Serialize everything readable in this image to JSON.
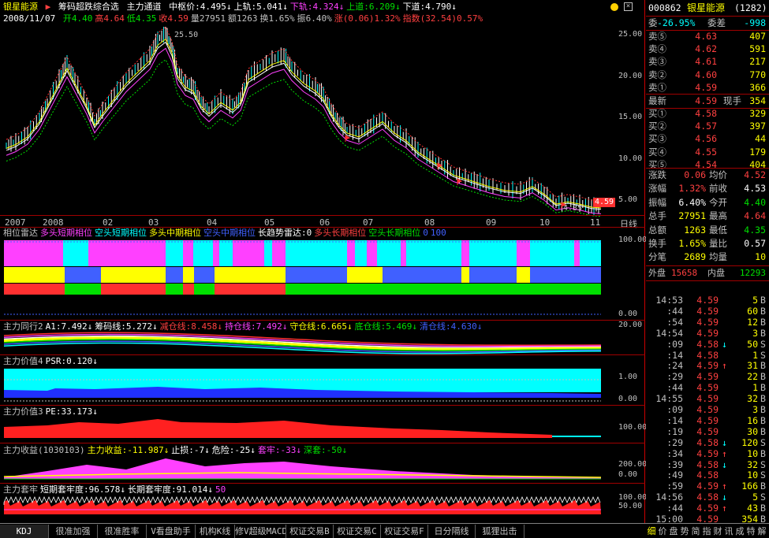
{
  "header": {
    "stock_name": "银星能源",
    "indicator_title": "筹码超跌综合选",
    "channel_label": "主力通道",
    "channel_values": [
      {
        "label": "中枢价:4.495",
        "color": "#ffffff"
      },
      {
        "label": "上轨:5.041",
        "color": "#ffffff"
      },
      {
        "label": "下轨:4.324",
        "color": "#ff40ff"
      },
      {
        "label": "上道:6.209",
        "color": "#00e000"
      },
      {
        "label": "下道:4.790",
        "color": "#ffffff"
      }
    ],
    "date": "2008/11/07",
    "quote_items": [
      {
        "label": "开4.40",
        "color": "#00e000"
      },
      {
        "label": "高4.64",
        "color": "#ff4040"
      },
      {
        "label": "低4.35",
        "color": "#00e000"
      },
      {
        "label": "收4.59",
        "color": "#ff4040"
      },
      {
        "label": "量27951",
        "color": "#c0c0c0"
      },
      {
        "label": "额1263",
        "color": "#c0c0c0"
      },
      {
        "label": "换1.65%",
        "color": "#c0c0c0"
      },
      {
        "label": "振6.40%",
        "color": "#c0c0c0"
      },
      {
        "label": "涨(0.06)1.32%",
        "color": "#ff4040"
      },
      {
        "label": "指数(32.54)0.57%",
        "color": "#ff4040"
      }
    ]
  },
  "main_chart": {
    "y_ticks": [
      "25.00",
      "20.00",
      "15.00",
      "10.00",
      "5.00"
    ],
    "peak_label": "25.50",
    "low_label": "4.35",
    "current_price": "4.59",
    "x_labels": [
      "2007",
      "2008",
      "02",
      "03",
      "04",
      "05",
      "06",
      "07",
      "08",
      "09",
      "10",
      "11"
    ],
    "period": "日线"
  },
  "panel1": {
    "items": [
      {
        "label": "相位雷达",
        "color": "#c0c0c0"
      },
      {
        "label": "多头短期相位",
        "color": "#ff40ff"
      },
      {
        "label": "空头短期相位",
        "color": "#00ffff"
      },
      {
        "label": "多头中期相位",
        "color": "#ffff00"
      },
      {
        "label": "空头中期相位",
        "color": "#4060ff"
      },
      {
        "label": "长趋势雷达:0",
        "color": "#ffffff"
      },
      {
        "label": "多头长期相位",
        "color": "#ff4040"
      },
      {
        "label": "空头长期相位",
        "color": "#00e000"
      },
      {
        "label": "0",
        "color": "#4060ff"
      },
      {
        "label": "100",
        "color": "#4060ff"
      }
    ],
    "ticks": [
      "100.00",
      "0.00"
    ]
  },
  "panel2": {
    "items": [
      {
        "label": "主力同行2",
        "color": "#c0c0c0"
      },
      {
        "label": "A1:7.492",
        "color": "#ffffff"
      },
      {
        "label": "筹码线:5.272",
        "color": "#ffffff"
      },
      {
        "label": "减仓线:8.458",
        "color": "#ff4040"
      },
      {
        "label": "持仓线:7.492",
        "color": "#ff40ff"
      },
      {
        "label": "守仓线:6.665",
        "color": "#ffff00"
      },
      {
        "label": "底仓线:5.469",
        "color": "#00e000"
      },
      {
        "label": "清仓线:4.630",
        "color": "#4060ff"
      }
    ],
    "ticks": [
      "20.00"
    ]
  },
  "panel3": {
    "items": [
      {
        "label": "主力价值4",
        "color": "#c0c0c0"
      },
      {
        "label": "PSR:0.120",
        "color": "#ffffff"
      }
    ],
    "ticks": [
      "1.00",
      "0.00"
    ]
  },
  "panel4": {
    "items": [
      {
        "label": "主力价值3",
        "color": "#c0c0c0"
      },
      {
        "label": "PE:33.173",
        "color": "#ffffff"
      }
    ],
    "ticks": [
      "100.00"
    ]
  },
  "panel5": {
    "items": [
      {
        "label": "主力收益(1030103)",
        "color": "#c0c0c0"
      },
      {
        "label": "主力收益:-11.987",
        "color": "#ffff00"
      },
      {
        "label": "止损:-7",
        "color": "#ffffff"
      },
      {
        "label": "危险:-25",
        "color": "#ffffff"
      },
      {
        "label": "套牢:-33",
        "color": "#ff40ff"
      },
      {
        "label": "深套:-50",
        "color": "#00e000"
      }
    ],
    "ticks": [
      "200.00",
      "0.00"
    ]
  },
  "panel6": {
    "items": [
      {
        "label": "主力套牢",
        "color": "#c0c0c0"
      },
      {
        "label": "短期套牢度:96.578",
        "color": "#ffffff"
      },
      {
        "label": "长期套牢度:91.014",
        "color": "#ffffff"
      },
      {
        "label": "50",
        "color": "#ff40ff"
      }
    ],
    "ticks": [
      "100.00",
      "50.00"
    ]
  },
  "quote_panel": {
    "code": "000862",
    "name": "银星能源",
    "num": "(1282)",
    "weibi_label": "委",
    "weibi": "-26.95%",
    "weicha_label": "委差",
    "weicha": "-998",
    "asks": [
      {
        "label": "卖⑤",
        "price": "4.63",
        "vol": "407"
      },
      {
        "label": "卖④",
        "price": "4.62",
        "vol": "591"
      },
      {
        "label": "卖③",
        "price": "4.61",
        "vol": "217"
      },
      {
        "label": "卖②",
        "price": "4.60",
        "vol": "770"
      },
      {
        "label": "卖①",
        "price": "4.59",
        "vol": "366"
      }
    ],
    "last_label": "最新",
    "last": "4.59",
    "hand_label": "现手",
    "hand": "354",
    "bids": [
      {
        "label": "买①",
        "price": "4.58",
        "vol": "329"
      },
      {
        "label": "买②",
        "price": "4.57",
        "vol": "397"
      },
      {
        "label": "买③",
        "price": "4.56",
        "vol": "44"
      },
      {
        "label": "买④",
        "price": "4.55",
        "vol": "179"
      },
      {
        "label": "买⑤",
        "price": "4.54",
        "vol": "404"
      }
    ],
    "stats": [
      {
        "l1": "涨跌",
        "v1": "0.06",
        "c1": "#ff4040",
        "l2": "均价",
        "v2": "4.52",
        "c2": "#ff4040"
      },
      {
        "l1": "涨幅",
        "v1": "1.32%",
        "c1": "#ff4040",
        "l2": "前收",
        "v2": "4.53",
        "c2": "#ffffff"
      },
      {
        "l1": "振幅",
        "v1": "6.40%",
        "c1": "#ffffff",
        "l2": "今开",
        "v2": "4.40",
        "c2": "#00e000"
      },
      {
        "l1": "总手",
        "v1": "27951",
        "c1": "#ffff00",
        "l2": "最高",
        "v2": "4.64",
        "c2": "#ff4040"
      },
      {
        "l1": "总额",
        "v1": "1263",
        "c1": "#ffff00",
        "l2": "最低",
        "v2": "4.35",
        "c2": "#00e000"
      },
      {
        "l1": "换手",
        "v1": "1.65%",
        "c1": "#ffff00",
        "l2": "量比",
        "v2": "0.57",
        "c2": "#ffffff"
      },
      {
        "l1": "分笔",
        "v1": "2689",
        "c1": "#ffff00",
        "l2": "均量",
        "v2": "10",
        "c2": "#ffff00"
      }
    ],
    "outer_label": "外盘",
    "outer": "15658",
    "inner_label": "内盘",
    "inner": "12293"
  },
  "ticks": [
    {
      "t": "14:53",
      "p": "4.59",
      "a": "",
      "q": "5",
      "s": "B",
      "pc": "#ff4040",
      "ac": "#ff4040"
    },
    {
      "t": ":44",
      "p": "4.59",
      "a": "",
      "q": "60",
      "s": "B",
      "pc": "#ff4040",
      "ac": "#ff4040"
    },
    {
      "t": ":54",
      "p": "4.59",
      "a": "",
      "q": "12",
      "s": "B",
      "pc": "#ff4040",
      "ac": "#ff4040"
    },
    {
      "t": "14:54",
      "p": "4.59",
      "a": "",
      "q": "3",
      "s": "B",
      "pc": "#ff4040",
      "ac": "#ff4040"
    },
    {
      "t": ":09",
      "p": "4.58",
      "a": "↓",
      "q": "50",
      "s": "S",
      "pc": "#ff4040",
      "ac": "#00ffff"
    },
    {
      "t": ":14",
      "p": "4.58",
      "a": "",
      "q": "1",
      "s": "S",
      "pc": "#ff4040",
      "ac": "#00ffff"
    },
    {
      "t": ":24",
      "p": "4.59",
      "a": "↑",
      "q": "31",
      "s": "B",
      "pc": "#ff4040",
      "ac": "#ff4040"
    },
    {
      "t": ":29",
      "p": "4.59",
      "a": "",
      "q": "22",
      "s": "B",
      "pc": "#ff4040",
      "ac": "#ff4040"
    },
    {
      "t": ":44",
      "p": "4.59",
      "a": "",
      "q": "1",
      "s": "B",
      "pc": "#ff4040",
      "ac": "#ff4040"
    },
    {
      "t": "14:55",
      "p": "4.59",
      "a": "",
      "q": "32",
      "s": "B",
      "pc": "#ff4040",
      "ac": "#ff4040"
    },
    {
      "t": ":09",
      "p": "4.59",
      "a": "",
      "q": "3",
      "s": "B",
      "pc": "#ff4040",
      "ac": "#ff4040"
    },
    {
      "t": ":14",
      "p": "4.59",
      "a": "",
      "q": "16",
      "s": "B",
      "pc": "#ff4040",
      "ac": "#ff4040"
    },
    {
      "t": ":19",
      "p": "4.59",
      "a": "",
      "q": "30",
      "s": "B",
      "pc": "#ff4040",
      "ac": "#ff4040"
    },
    {
      "t": ":29",
      "p": "4.58",
      "a": "↓",
      "q": "120",
      "s": "S",
      "pc": "#ff4040",
      "ac": "#00ffff"
    },
    {
      "t": ":34",
      "p": "4.59",
      "a": "↑",
      "q": "10",
      "s": "B",
      "pc": "#ff4040",
      "ac": "#ff4040"
    },
    {
      "t": ":39",
      "p": "4.58",
      "a": "↓",
      "q": "32",
      "s": "S",
      "pc": "#ff4040",
      "ac": "#00ffff"
    },
    {
      "t": ":49",
      "p": "4.58",
      "a": "",
      "q": "10",
      "s": "S",
      "pc": "#ff4040",
      "ac": "#00ffff"
    },
    {
      "t": ":59",
      "p": "4.59",
      "a": "↑",
      "q": "166",
      "s": "B",
      "pc": "#ff4040",
      "ac": "#ff4040"
    },
    {
      "t": "14:56",
      "p": "4.58",
      "a": "↓",
      "q": "5",
      "s": "S",
      "pc": "#ff4040",
      "ac": "#00ffff"
    },
    {
      "t": ":44",
      "p": "4.59",
      "a": "↑",
      "q": "43",
      "s": "B",
      "pc": "#ff4040",
      "ac": "#ff4040"
    },
    {
      "t": "15:00",
      "p": "4.59",
      "a": "",
      "q": "354",
      "s": "B",
      "pc": "#ff4040",
      "ac": "#ff4040"
    }
  ],
  "bottom_tabs": [
    "KDJ",
    "很准加强",
    "很准胜率",
    "V看盘助手",
    "机构K线",
    "修V超级MACD",
    "权证交易B",
    "权证交易C",
    "权证交易F",
    "日分隔线",
    "狐狸出击"
  ],
  "right_bottom_tabs": [
    "细",
    "价",
    "盘",
    "势",
    "简",
    "指",
    "财",
    "讯",
    "成",
    "特",
    "解"
  ]
}
